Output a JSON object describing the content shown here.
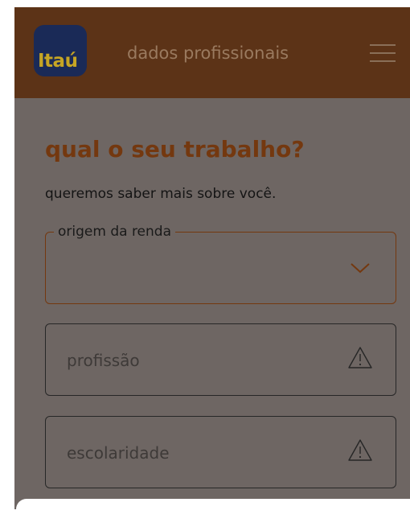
{
  "header": {
    "logo_text": "Itaú",
    "title": "dados profissionais",
    "menu_icon": "hamburger-menu-icon"
  },
  "main": {
    "title": "qual o seu trabalho?",
    "subtitle": "queremos saber mais sobre você."
  },
  "form": {
    "income_source": {
      "label": "origem da renda",
      "value": "",
      "icon": "chevron-down-icon"
    },
    "profession": {
      "placeholder": "profissão",
      "icon": "warning-icon"
    },
    "education": {
      "placeholder": "escolaridade",
      "icon": "warning-icon"
    }
  },
  "colors": {
    "header_bg": "#5c3317",
    "overlay_bg": "#6e6663",
    "accent": "#74380f",
    "logo_bg": "#1a2a57",
    "logo_text": "#c6a524"
  }
}
